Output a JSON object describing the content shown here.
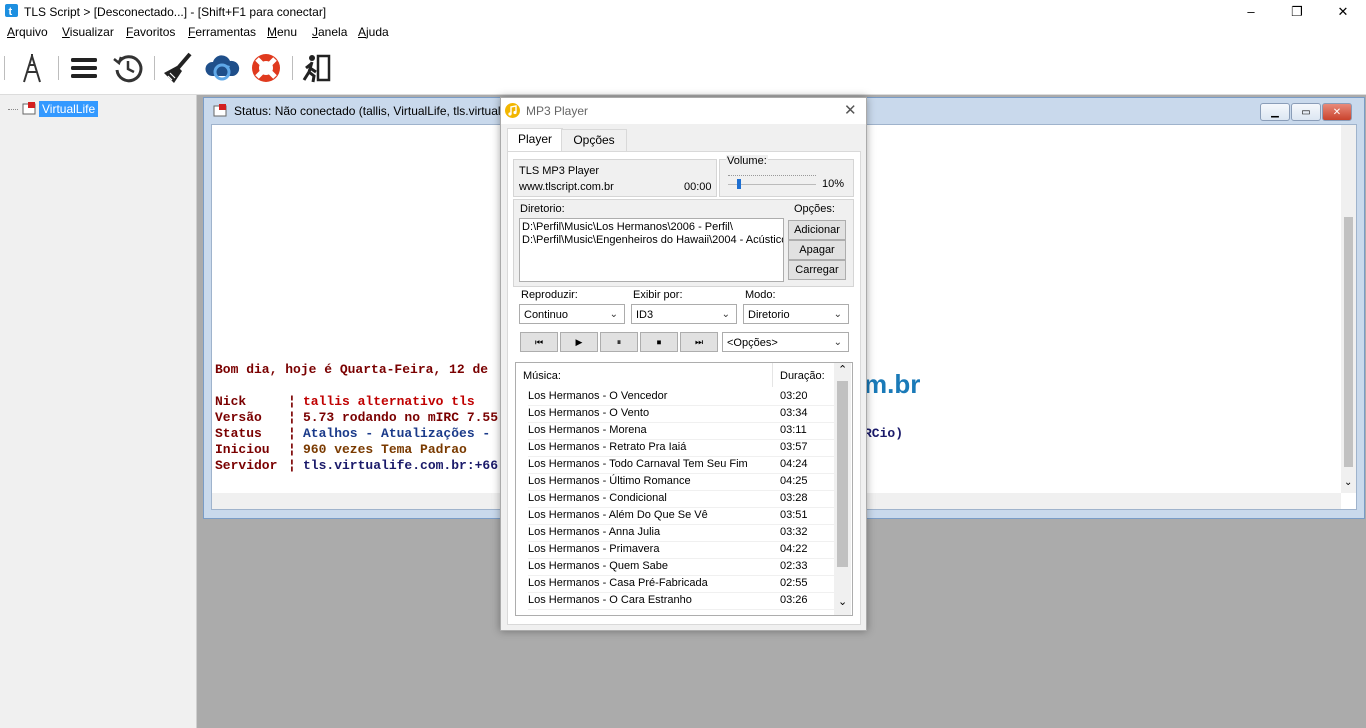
{
  "window": {
    "title": "TLS Script > [Desconectado...] - [Shift+F1 para conectar]",
    "minimize": "–",
    "maximize": "❐",
    "close": "✕"
  },
  "menu": [
    "Arquivo",
    "Visualizar",
    "Favoritos",
    "Ferramentas",
    "Menu",
    "Janela",
    "Ajuda"
  ],
  "menu_underline": [
    "A",
    "V",
    "F",
    "F",
    "M",
    "J",
    "A"
  ],
  "toolbar": {
    "icons": [
      "antenna-icon",
      "menu-icon",
      "clock-icon",
      "brush-icon",
      "cloud-sync-icon",
      "lifebuoy-icon",
      "exit-icon"
    ]
  },
  "tree": {
    "item": "VirtualLife"
  },
  "status_window": {
    "title": "Status: Não conectado (tallis, VirtualLife, tls.virtualife.com.br)",
    "greeting": "Bom dia, hoje é Quarta-Feira, 12 de",
    "logo_fragment": "m.br",
    "lines": [
      {
        "label": "Nick",
        "value": "tallis alternativo tls"
      },
      {
        "label": "Versão",
        "value": "5.73 rodando no mIRC 7.55"
      },
      {
        "label": "Status",
        "value": "Atalhos - Atualizações -"
      },
      {
        "label": "Iniciou",
        "value": "960 vezes Tema Padrao"
      },
      {
        "label": "Servidor",
        "value": "tls.virtualife.com.br:+66"
      }
    ],
    "tail": "RCio)",
    "sep": "¦"
  },
  "mp3": {
    "title": "MP3 Player",
    "tabs": [
      "Player",
      "Opções"
    ],
    "player_name": "TLS MP3 Player",
    "website": "www.tlscript.com.br",
    "time": "00:00",
    "volume_label": "Volume:",
    "volume_value": "10%",
    "volume_level": 0.1,
    "dir_label": "Diretorio:",
    "dirs": [
      "D:\\Perfil\\Music\\Los Hermanos\\2006 - Perfil\\",
      "D:\\Perfil\\Music\\Engenheiros do Hawaii\\2004 - Acústico"
    ],
    "options_label": "Opções:",
    "buttons": [
      "Adicionar",
      "Apagar",
      "Carregar"
    ],
    "reproduzir_label": "Reproduzir:",
    "reproduzir_value": "Continuo",
    "exibir_label": "Exibir por:",
    "exibir_value": "ID3",
    "modo_label": "Modo:",
    "modo_value": "Diretorio",
    "controls": [
      "⏮",
      "▶",
      "⏸",
      "⏹",
      "⏭"
    ],
    "opcoes_select": "<Opções>",
    "col_music": "Música:",
    "col_duration": "Duração:",
    "tracks": [
      {
        "name": "Los Hermanos - O Vencedor",
        "dur": "03:20"
      },
      {
        "name": "Los Hermanos - O Vento",
        "dur": "03:34"
      },
      {
        "name": "Los Hermanos - Morena",
        "dur": "03:11"
      },
      {
        "name": "Los Hermanos - Retrato Pra Iaiá",
        "dur": "03:57"
      },
      {
        "name": "Los Hermanos - Todo Carnaval Tem Seu Fim",
        "dur": "04:24"
      },
      {
        "name": "Los Hermanos - Último Romance",
        "dur": "04:25"
      },
      {
        "name": "Los Hermanos - Condicional",
        "dur": "03:28"
      },
      {
        "name": "Los Hermanos - Além Do Que Se Vê",
        "dur": "03:51"
      },
      {
        "name": "Los Hermanos - Anna Julia",
        "dur": "03:32"
      },
      {
        "name": "Los Hermanos - Primavera",
        "dur": "04:22"
      },
      {
        "name": "Los Hermanos - Quem Sabe",
        "dur": "02:33"
      },
      {
        "name": "Los Hermanos - Casa Pré-Fabricada",
        "dur": "02:55"
      },
      {
        "name": "Los Hermanos - O Cara Estranho",
        "dur": "03:26"
      }
    ]
  }
}
